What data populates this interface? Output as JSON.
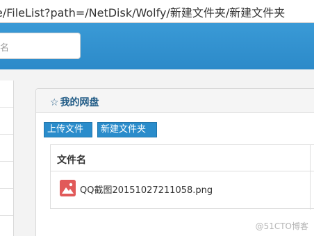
{
  "browser": {
    "url": "e/FileList?path=/NetDisk/Wolfy/新建文件夹/新建文件夹"
  },
  "header": {
    "search_placeholder": "名"
  },
  "panel": {
    "title_star": "☆",
    "title": "我的网盘"
  },
  "toolbar": {
    "upload_label": "上传文件",
    "new_folder_label": "新建文件夹"
  },
  "table": {
    "columns": [
      "文件名"
    ],
    "rows": [
      {
        "name": "QQ截图20151027211058.png",
        "icon": "image-file-icon"
      }
    ]
  },
  "watermark": "@51CTO博客",
  "colors": {
    "header_blue": "#2c8ac9",
    "button_blue": "#2a8ccb",
    "title_blue": "#1f5a85",
    "file_icon_red": "#e15a5a"
  }
}
